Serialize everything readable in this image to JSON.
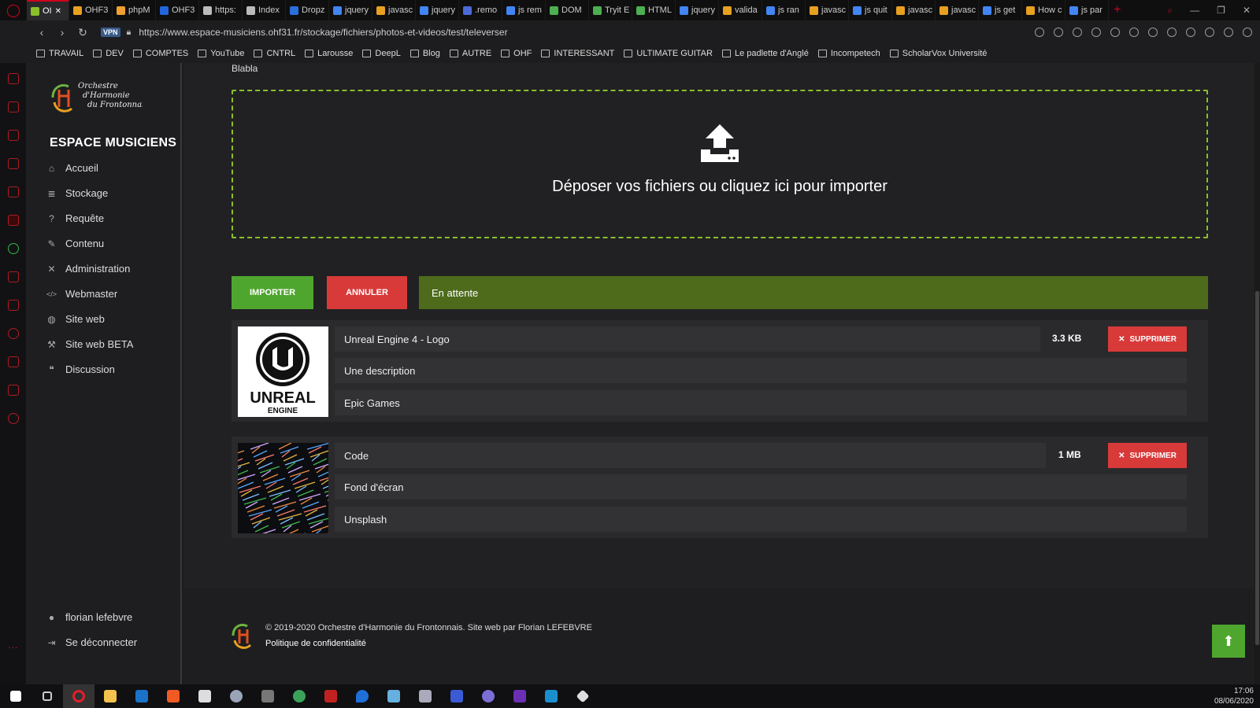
{
  "browser": {
    "tabs": [
      "OI",
      "OHF3",
      "phpM",
      "OHF3",
      "https:",
      "Index",
      "Dropz",
      "jquery",
      "javasc",
      "jquery",
      ".remo",
      "js rem",
      "DOM",
      "Tryit E",
      "HTML",
      "jquery",
      "valida",
      "js ran",
      "javasc",
      "js quit",
      "javasc",
      "javasc",
      "js get",
      "How c",
      "js par"
    ],
    "url": "https://www.espace-musiciens.ohf31.fr/stockage/fichiers/photos-et-videos/test/televerser",
    "vpn": "VPN",
    "bookmarks": [
      "TRAVAIL",
      "DEV",
      "COMPTES",
      "YouTube",
      "CNTRL",
      "Larousse",
      "DeepL",
      "Blog",
      "AUTRE",
      "OHF",
      "INTERESSANT",
      "ULTIMATE GUITAR",
      "Le padlette d'Anglé",
      "Incompetech",
      "ScholarVox Université"
    ]
  },
  "sidebar": {
    "title": "ESPACE MUSICIENS",
    "items": [
      {
        "label": "Accueil",
        "icon": "home-icon"
      },
      {
        "label": "Stockage",
        "icon": "database-icon"
      },
      {
        "label": "Requête",
        "icon": "question-icon"
      },
      {
        "label": "Contenu",
        "icon": "edit-icon"
      },
      {
        "label": "Administration",
        "icon": "tools-icon"
      },
      {
        "label": "Webmaster",
        "icon": "code-icon"
      },
      {
        "label": "Site web",
        "icon": "globe-icon"
      },
      {
        "label": "Site web BETA",
        "icon": "hammer-icon"
      },
      {
        "label": "Discussion",
        "icon": "comments-icon"
      }
    ],
    "user": "florian lefebvre",
    "logout": "Se déconnecter"
  },
  "main": {
    "heading": "Blabla",
    "dropzone_text": "Déposer vos fichiers ou cliquez ici pour importer",
    "import_label": "IMPORTER",
    "cancel_label": "ANNULER",
    "status": "En attente",
    "delete_label": "SUPPRIMER",
    "files": [
      {
        "title": "Unreal Engine 4 - Logo",
        "size": "3.3 KB",
        "description": "Une description",
        "source": "Epic Games",
        "thumb_text": "UNREAL",
        "thumb_sub": "ENGINE"
      },
      {
        "title": "Code",
        "size": "1 MB",
        "description": "Fond d'écran",
        "source": "Unsplash"
      }
    ]
  },
  "footer": {
    "copyright": "© 2019-2020 Orchestre d'Harmonie du Frontonnais. Site web par Florian LEFEBVRE",
    "privacy": "Politique de confidentialité"
  },
  "taskbar": {
    "time": "17:06",
    "date": "08/06/2020"
  },
  "colors": {
    "accent_green": "#4fa62e",
    "danger_red": "#d83a3a",
    "status_green": "#4d6b1b",
    "dropzone_border": "#8bbf2a"
  }
}
